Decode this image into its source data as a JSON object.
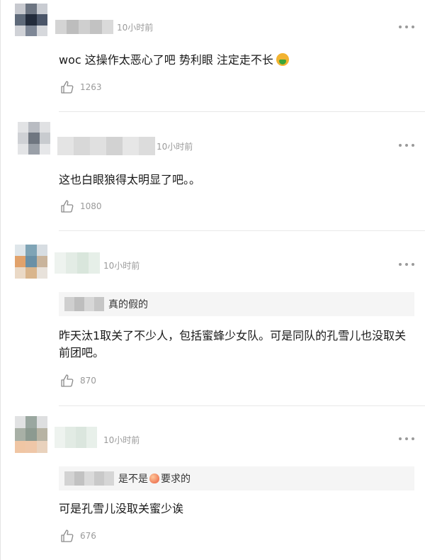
{
  "comments": [
    {
      "time": "10小时前",
      "text": "woc 这操作太恶心了吧 势利眼 注定走不长",
      "emoji": "nauseated-face",
      "likes": "1263"
    },
    {
      "time": "10小时前",
      "text": "这也白眼狼得太明显了吧。。",
      "likes": "1080"
    },
    {
      "time": "10小时前",
      "quote_text": "真的假的",
      "text": "昨天汰1取关了不少人，包括蜜蜂少女队。可是同队的孔雪儿也没取关前团吧。",
      "likes": "870"
    },
    {
      "time": "10小时前",
      "quote_text_before": "是不是",
      "quote_emoji": "peach",
      "quote_text_after": "要求的",
      "text": "可是孔雪儿没取关蜜少诶",
      "likes": "676"
    }
  ],
  "icons": {
    "like": "thumbs-up-icon",
    "more": "more-dots-icon"
  },
  "colors": {
    "meta_text": "#9a9a9a",
    "quote_bg": "#f5f5f5",
    "divider": "#e8e8e8"
  }
}
